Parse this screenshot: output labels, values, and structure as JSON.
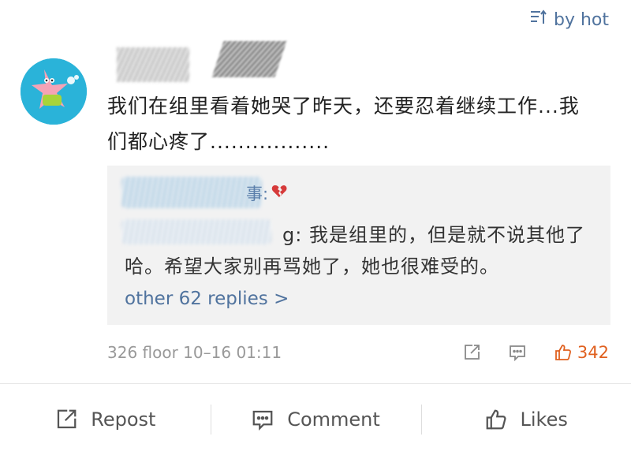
{
  "sort": {
    "label": "by hot"
  },
  "comment": {
    "text": "我们在组里看着她哭了昨天，还要忍着继续工作...我们都心疼了.................",
    "reply": {
      "author_suffix": "事:",
      "text": "g: 我是组里的，但是就不说其他了哈。希望大家别再骂她了，她也很难受的。",
      "more_label": "other 62 replies >"
    },
    "meta": {
      "floor": "326 floor 10–16 01:11",
      "likes": "342"
    }
  },
  "bottom_bar": {
    "repost": "Repost",
    "comment": "Comment",
    "likes": "Likes"
  },
  "icons": {
    "sort": "sort-icon",
    "avatar": "patrick-star-avatar",
    "broken_heart": "broken-heart-icon",
    "repost": "repost-icon",
    "comment": "comment-icon",
    "like": "thumbs-up-icon"
  },
  "colors": {
    "link": "#50739e",
    "like_orange": "#e0601f",
    "reply_bg": "#f2f2f2"
  }
}
